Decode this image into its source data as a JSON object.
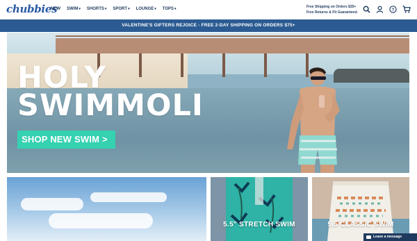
{
  "brand": {
    "logo": "chubbies"
  },
  "nav": [
    {
      "label": "NEW",
      "dropdown": false
    },
    {
      "label": "SWIM",
      "dropdown": true
    },
    {
      "label": "SHORTS",
      "dropdown": true
    },
    {
      "label": "SPORT",
      "dropdown": true
    },
    {
      "label": "LOUNGE",
      "dropdown": true
    },
    {
      "label": "TOPS",
      "dropdown": true
    }
  ],
  "header_promo": {
    "line1": "Free Shipping on Orders $35+",
    "line2": "Free Returns & Fit Guaranteed."
  },
  "header_icons": [
    "search-icon",
    "account-icon",
    "help-icon",
    "cart-icon"
  ],
  "banner": {
    "text": "VALENTINE'S GIFTERS REJOICE - FREE 2-DAY SHIPPING ON ORDERS $75+"
  },
  "hero": {
    "title_line1": "HOLY",
    "title_line2": "SWIMMOLI",
    "cta": "SHOP NEW SWIM >"
  },
  "tiles": [
    {
      "label": ""
    },
    {
      "label": "5.5\" STRETCH SWIM"
    },
    {
      "label": "5.5 CLASSIC SWIM"
    }
  ],
  "chat": {
    "label": "Leave a message"
  },
  "colors": {
    "brand_blue": "#2a5aa5",
    "banner_blue": "#2b5b92",
    "cta_teal": "#35d1b1",
    "navy": "#1f3a5f"
  }
}
